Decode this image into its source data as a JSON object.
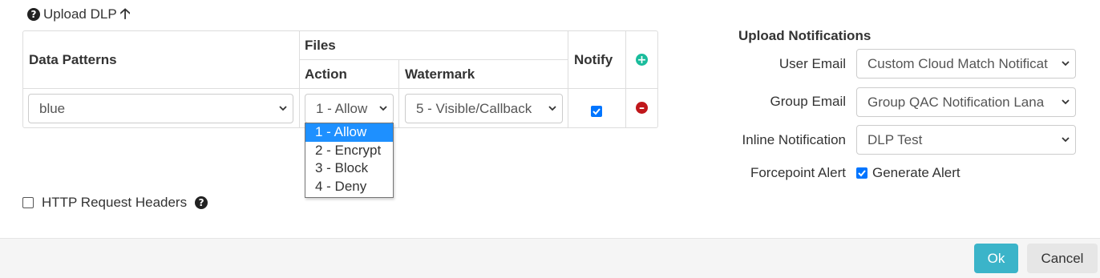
{
  "upload": {
    "title": "Upload DLP",
    "help_icon": "question-circle-icon",
    "arrow_icon": "arrow-up-icon"
  },
  "table": {
    "headers": {
      "data_patterns": "Data Patterns",
      "files": "Files",
      "action": "Action",
      "watermark": "Watermark",
      "notify": "Notify"
    },
    "row": {
      "data_pattern": "blue",
      "action": "1 - Allow",
      "watermark": "5 - Visible/Callback",
      "notify_checked": true
    },
    "add_icon": "plus-circle-icon",
    "remove_icon": "minus-circle-icon"
  },
  "action_dropdown": {
    "options": [
      "1 - Allow",
      "2 - Encrypt",
      "3 - Block",
      "4 - Deny"
    ],
    "selected_index": 0
  },
  "http_headers": {
    "label": "HTTP Request Headers",
    "checked": false
  },
  "notifications": {
    "title": "Upload Notifications",
    "user_email_label": "User Email",
    "user_email_value": "Custom Cloud Match Notificat",
    "group_email_label": "Group Email",
    "group_email_value": "Group QAC Notification Lana",
    "inline_label": "Inline Notification",
    "inline_value": "DLP Test",
    "forcepoint_label": "Forcepoint Alert",
    "forcepoint_checkbox_label": "Generate Alert",
    "forcepoint_checked": true
  },
  "footer": {
    "ok_label": "Ok",
    "cancel_label": "Cancel"
  },
  "colors": {
    "ok_button": "#3bb4c9",
    "checkbox": "#0075ff",
    "add": "#1abc9c",
    "remove": "#c0171b",
    "selected_option": "#1e90ff"
  }
}
